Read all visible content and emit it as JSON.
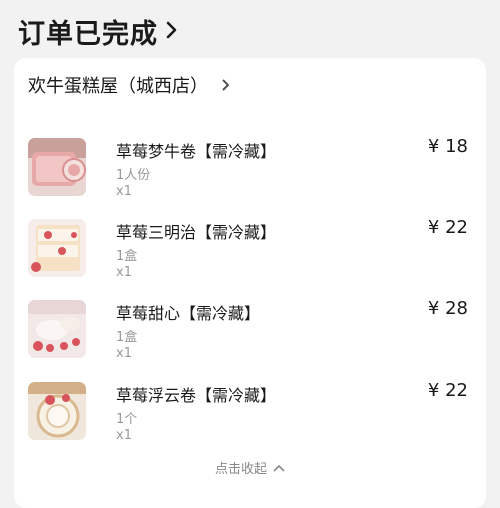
{
  "header": {
    "title": "订单已完成"
  },
  "store": {
    "name": "欢牛蛋糕屋（城西店）"
  },
  "items": [
    {
      "name": "草莓梦牛卷【需冷藏】",
      "spec": "1人份",
      "qty": "x1",
      "price": "¥ 18"
    },
    {
      "name": "草莓三明治【需冷藏】",
      "spec": "1盒",
      "qty": "x1",
      "price": "¥ 22"
    },
    {
      "name": "草莓甜心【需冷藏】",
      "spec": "1盒",
      "qty": "x1",
      "price": "¥ 28"
    },
    {
      "name": "草莓浮云卷【需冷藏】",
      "spec": "1个",
      "qty": "x1",
      "price": "¥ 22"
    }
  ],
  "collapse": {
    "label": "点击收起"
  },
  "colors": {
    "background": "#f2f2f2",
    "card": "#ffffff",
    "muted": "#999999"
  },
  "icons": {
    "header": "chevron-right-icon",
    "store": "chevron-right-icon",
    "collapse": "chevron-up-icon"
  }
}
